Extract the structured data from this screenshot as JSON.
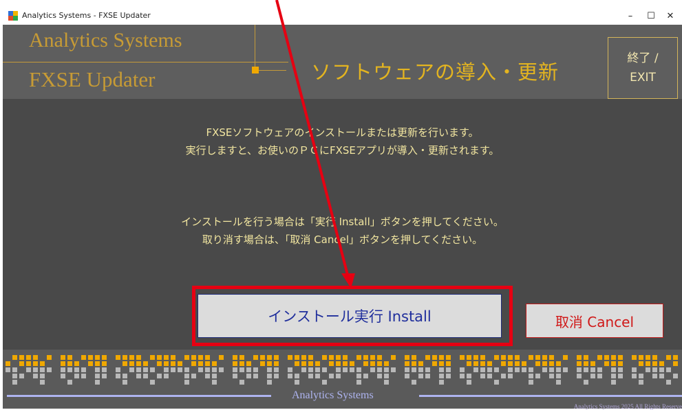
{
  "window": {
    "title": "Analytics Systems - FXSE Updater",
    "controls": {
      "minimize": "–",
      "maximize": "☐",
      "close": "✕"
    }
  },
  "header": {
    "brand_line1": "Analytics Systems",
    "brand_line2": "FXSE Updater",
    "subtitle": "ソフトウェアの導入・更新",
    "exit_label_line1": "終了 /",
    "exit_label_line2": "EXIT"
  },
  "content": {
    "message_line1": "FXSEソフトウェアのインストールまたは更新を行います。",
    "message_line2": "実行しますと、お使いのＰＣにFXSEアプリが導入・更新されます。",
    "instruction_line1": "インストールを行う場合は「実行 Install」ボタンを押してください。",
    "instruction_line2": "取り消す場合は、「取消 Cancel」ボタンを押してください。",
    "install_button": "インストール実行 Install",
    "cancel_button": "取消 Cancel"
  },
  "footer": {
    "brand": "Analytics Systems",
    "copyright": "Analytics Systems 2025 All Rights Reserve"
  },
  "colors": {
    "header_bg": "#5e5e5e",
    "content_bg": "#494949",
    "brand_gold": "#c79b35",
    "subtitle_gold": "#e3b420",
    "message_text": "#f2e6a0",
    "install_text": "#1f2e9c",
    "cancel_text": "#d01818",
    "highlight_red": "#e60012",
    "footer_accent": "#aeb4f0",
    "dot_orange": "#f0a800",
    "dot_gray": "#b8b8b8"
  },
  "icons": {
    "app": "app-icon",
    "arrow": "annotation-arrow-icon"
  }
}
